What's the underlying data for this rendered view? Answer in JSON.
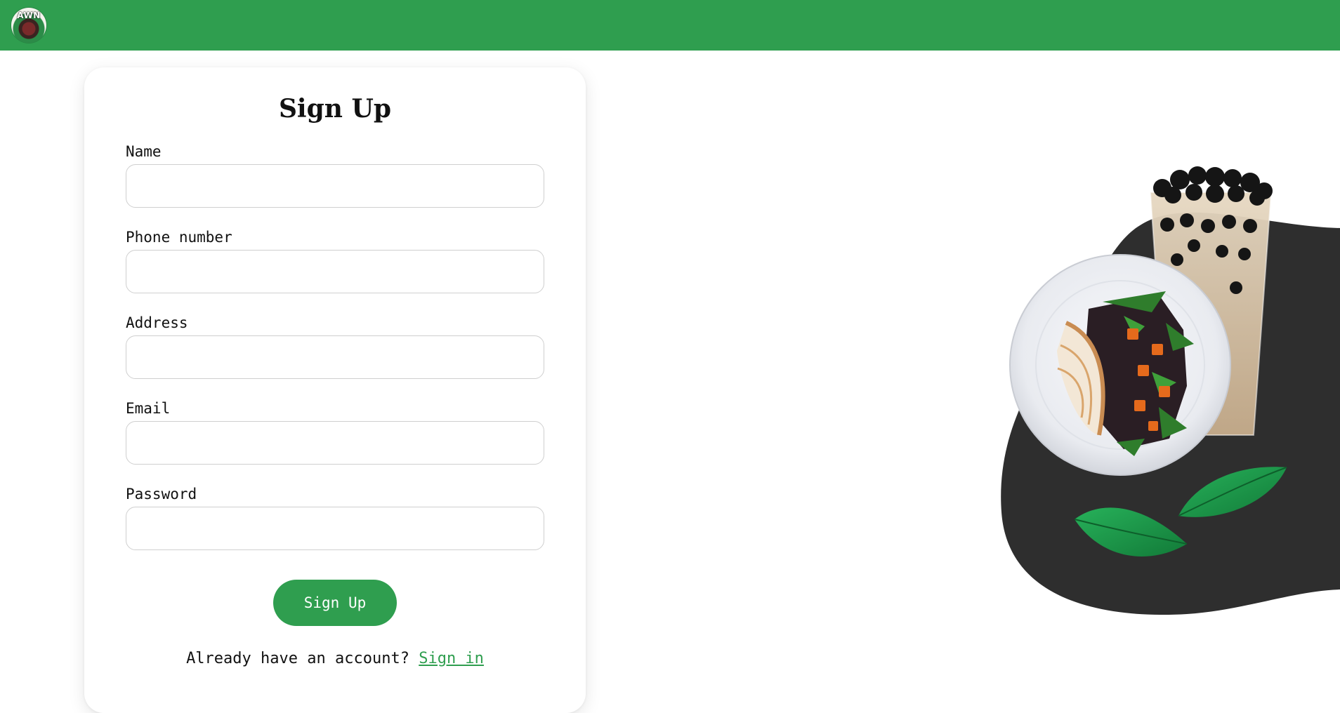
{
  "header": {
    "logo_text": "AWN"
  },
  "form": {
    "title": "Sign Up",
    "fields": [
      {
        "label": "Name",
        "value": "",
        "placeholder": ""
      },
      {
        "label": "Phone number",
        "value": "",
        "placeholder": ""
      },
      {
        "label": "Address",
        "value": "",
        "placeholder": ""
      },
      {
        "label": "Email",
        "value": "",
        "placeholder": ""
      },
      {
        "label": "Password",
        "value": "",
        "placeholder": ""
      }
    ],
    "submit_label": "Sign Up",
    "footer_text": "Already have an account?",
    "signin_label": "Sign in"
  },
  "colors": {
    "brand_green": "#2f9e4f",
    "blob_dark": "#2e2e2e",
    "leaf_green": "#1f9a4a"
  },
  "hero": {
    "items": [
      "bubble-tea-cup",
      "chicken-salad-plate",
      "leaf",
      "leaf"
    ]
  }
}
